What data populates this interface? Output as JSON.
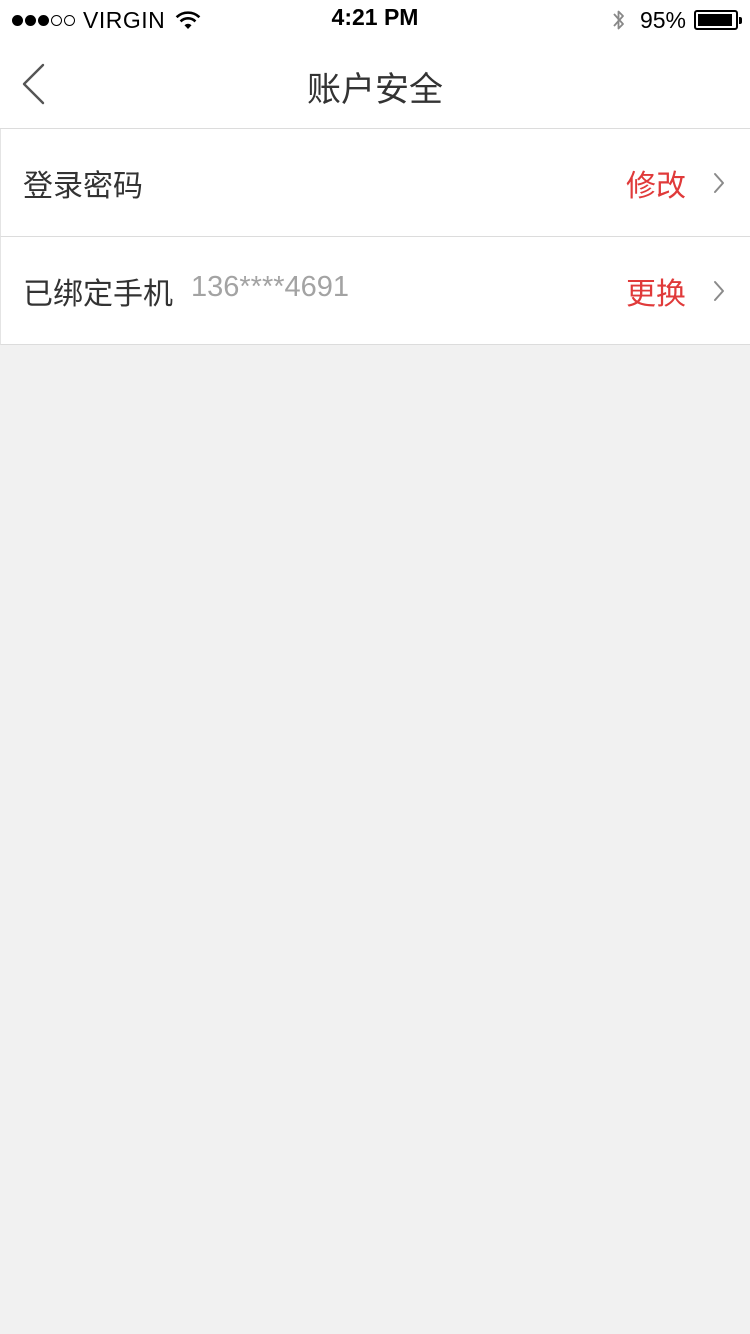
{
  "status_bar": {
    "carrier": "VIRGIN",
    "time": "4:21 PM",
    "battery_percent": "95%",
    "signal_bars_filled": 3,
    "signal_bars_total": 5,
    "battery_level": 0.95
  },
  "navbar": {
    "title": "账户安全",
    "back_icon": "chevron-left-icon"
  },
  "settings": [
    {
      "label": "登录密码",
      "value": "",
      "action": "修改"
    },
    {
      "label": "已绑定手机",
      "value": "136****4691",
      "action": "更换"
    }
  ],
  "colors": {
    "accent": "#e03a3a",
    "background": "#f1f1f1",
    "surface": "#ffffff",
    "divider": "#dcdcdc",
    "text_primary": "#333333",
    "text_secondary": "#a3a3a3"
  }
}
